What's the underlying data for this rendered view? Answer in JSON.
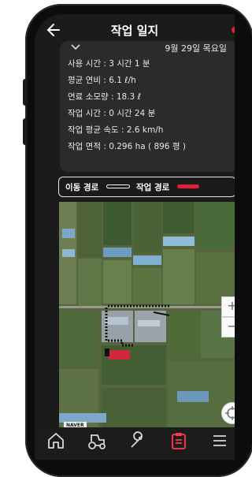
{
  "header": {
    "title": "작업 일지"
  },
  "stats": {
    "date": "9월 29일 목요일",
    "lines": [
      "사용 시간 : 3 시간 1 분",
      "평균 연비 : 6.1 ℓ/h",
      "연료 소모량 : 18.3 ℓ",
      "작업 시간 : 0 시간 24 분",
      "작업 평균 속도 : 2.6 km/h",
      "작업 면적 : 0.296 ha ( 896 평 )"
    ]
  },
  "legend": {
    "move_label": "이동 경로",
    "work_label": "작업 경로",
    "move_color": "#ffffff",
    "work_color": "#e0213a"
  },
  "map": {
    "zoom_in": "+",
    "zoom_out": "−",
    "attribution": "NAVER"
  },
  "tabs": [
    {
      "label": "홈",
      "icon": "home-icon"
    },
    {
      "label": "상태",
      "icon": "tractor-icon"
    },
    {
      "label": "관리",
      "icon": "wrench-icon"
    },
    {
      "label": "일지",
      "icon": "clipboard-icon",
      "active": true
    },
    {
      "label": "더보",
      "icon": "menu-icon"
    }
  ],
  "colors": {
    "accent": "#e0213a",
    "background": "#1b1b1b",
    "card": "#2b2b2b"
  }
}
